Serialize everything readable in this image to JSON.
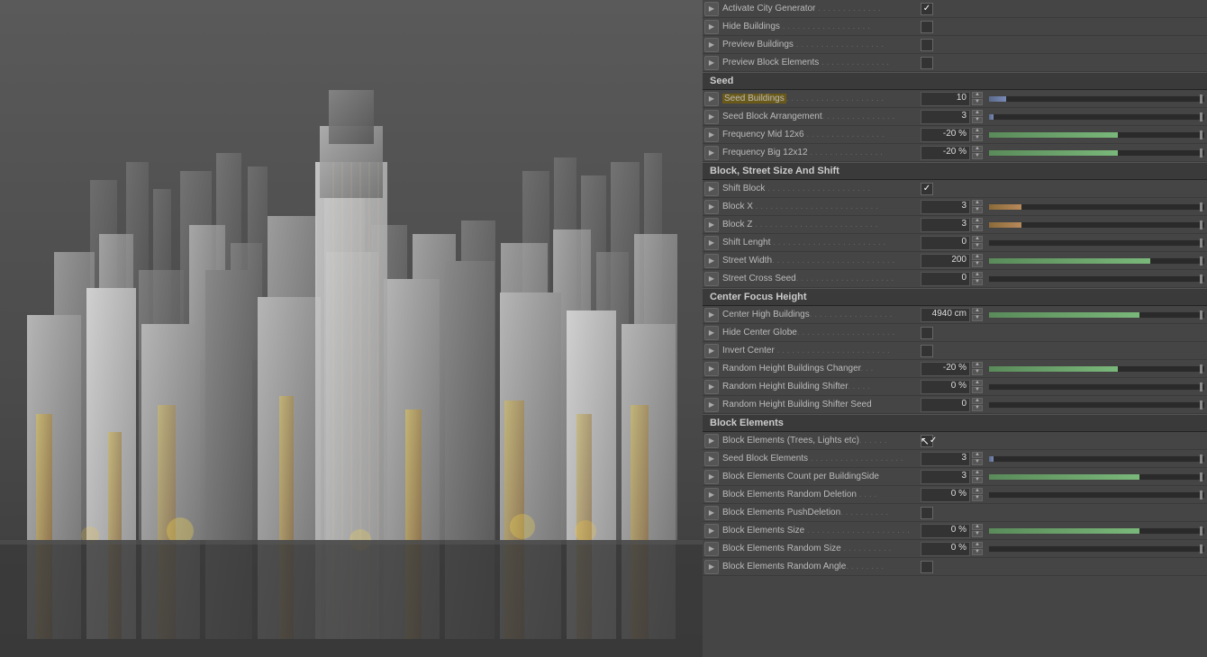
{
  "viewport": {
    "alt": "3D City Generator Viewport"
  },
  "panel": {
    "sections": [
      {
        "id": "top-controls",
        "label": null,
        "rows": [
          {
            "id": "activate-city",
            "label": "Activate City Generator",
            "dots": " . . . . . . . . . . . . .",
            "type": "checkbox",
            "checked": true
          },
          {
            "id": "hide-buildings",
            "label": "Hide Buildings",
            "dots": " . . . . . . . . . . . . . . . . . .",
            "type": "checkbox",
            "checked": false
          }
        ]
      },
      {
        "id": "preview-section",
        "label": null,
        "rows": [
          {
            "id": "preview-buildings",
            "label": "Preview Buildings",
            "dots": " . . . . . . . . . . . . . . . . . .",
            "type": "checkbox",
            "checked": false
          },
          {
            "id": "preview-block-elements",
            "label": "Preview Block Elements",
            "dots": " . . . . . . . . . . . . . .",
            "type": "checkbox",
            "checked": false
          }
        ]
      },
      {
        "id": "seed-section",
        "label": "Seed",
        "rows": [
          {
            "id": "seed-buildings",
            "label": "Seed Buildings",
            "dots": ". . . . . . . . . . . . . . . . . . . .",
            "type": "number-slider",
            "value": "10",
            "highlighted": true,
            "sliderPercent": 8,
            "sliderColor": "blue"
          },
          {
            "id": "seed-block-arrangement",
            "label": "Seed Block Arrangement",
            "dots": ". . . . . . . . . . . . . . .",
            "type": "number-slider",
            "value": "3",
            "sliderPercent": 2,
            "sliderColor": "blue"
          },
          {
            "id": "frequency-mid",
            "label": "Frequency Mid 12x6",
            "dots": " . . . . . . . . . . . . . . . .",
            "type": "number-slider",
            "value": "-20 %",
            "sliderPercent": 60,
            "sliderColor": "green"
          },
          {
            "id": "frequency-big",
            "label": "Frequency Big 12x12",
            "dots": " . . . . . . . . . . . . . . .",
            "type": "number-slider",
            "value": "-20 %",
            "sliderPercent": 60,
            "sliderColor": "green"
          }
        ]
      },
      {
        "id": "block-street-section",
        "label": "Block, Street Size And Shift",
        "rows": [
          {
            "id": "shift-block",
            "label": "Shift Block",
            "dots": " . . . . . . . . . . . . . . . . . . . . .",
            "type": "checkbox",
            "checked": true
          },
          {
            "id": "block-x",
            "label": "Block X",
            "dots": " . . . . . . . . . . . . . . . . . . . . . . . . .",
            "type": "number-slider",
            "value": "3",
            "sliderPercent": 15,
            "sliderColor": "orange"
          },
          {
            "id": "block-z",
            "label": "Block Z",
            "dots": " . . . . . . . . . . . . . . . . . . . . . . . . .",
            "type": "number-slider",
            "value": "3",
            "sliderPercent": 15,
            "sliderColor": "orange"
          },
          {
            "id": "shift-length",
            "label": "Shift Lenght",
            "dots": " . . . . . . . . . . . . . . . . . . . . . . .",
            "type": "number-slider",
            "value": "0",
            "sliderPercent": 0,
            "sliderColor": "green"
          },
          {
            "id": "street-width",
            "label": "Street Width",
            "dots": ". . . . . . . . . . . . . . . . . . . . . . . . .",
            "type": "number-slider",
            "value": "200",
            "sliderPercent": 75,
            "sliderColor": "green"
          },
          {
            "id": "street-cross-seed",
            "label": "Street Cross Seed",
            "dots": ". . . . . . . . . . . . . . . . . . . .",
            "type": "number-slider",
            "value": "0",
            "sliderPercent": 0,
            "sliderColor": "green"
          }
        ]
      },
      {
        "id": "center-focus-section",
        "label": "Center Focus Height",
        "rows": [
          {
            "id": "center-high-buildings",
            "label": "Center High Buildings",
            "dots": ". . . . . . . . . . . . . . . . .",
            "type": "number-slider",
            "value": "4940 cm",
            "sliderPercent": 70,
            "sliderColor": "green"
          },
          {
            "id": "hide-center-globe",
            "label": "Hide Center Globe",
            "dots": ". . . . . . . . . . . . . . . . . . . .",
            "type": "checkbox",
            "checked": false
          },
          {
            "id": "invert-center",
            "label": "Invert Center",
            "dots": " . . . . . . . . . . . . . . . . . . . . . . .",
            "type": "checkbox",
            "checked": false
          },
          {
            "id": "random-height-changer",
            "label": "Random Height Buildings Changer",
            "dots": ". . .",
            "type": "number-slider",
            "value": "-20 %",
            "sliderPercent": 60,
            "sliderColor": "green"
          },
          {
            "id": "random-height-shifter",
            "label": "Random Height Building Shifter",
            "dots": ". . . . .",
            "type": "number-slider",
            "value": "0 %",
            "sliderPercent": 0,
            "sliderColor": "green"
          },
          {
            "id": "random-height-shifter-seed",
            "label": "Random Height Building Shifter Seed",
            "dots": "",
            "type": "number-slider",
            "value": "0",
            "sliderPercent": 0,
            "sliderColor": "green"
          }
        ]
      },
      {
        "id": "block-elements-section",
        "label": "Block Elements",
        "rows": [
          {
            "id": "block-elements-trees",
            "label": "Block Elements (Trees, Lights etc)",
            "dots": ". . . . . .",
            "type": "checkbox",
            "checked": true,
            "hasCursor": true
          },
          {
            "id": "seed-block-elements",
            "label": "Seed Block Elements",
            "dots": " . . . . . . . . . . . . . . . . . . .",
            "type": "number-slider",
            "value": "3",
            "sliderPercent": 2,
            "sliderColor": "blue"
          },
          {
            "id": "block-elements-count",
            "label": "Block Elements Count per BuildingSide",
            "dots": "",
            "type": "number-slider",
            "value": "3",
            "sliderPercent": 70,
            "sliderColor": "green"
          },
          {
            "id": "block-elements-deletion",
            "label": "Block Elements Random Deletion",
            "dots": " . . . .",
            "type": "number-slider",
            "value": "0 %",
            "sliderPercent": 0,
            "sliderColor": "green"
          },
          {
            "id": "block-elements-pushdeletion",
            "label": "Block Elements PushDeletion",
            "dots": ". . . . . . . . . .",
            "type": "checkbox",
            "checked": false
          },
          {
            "id": "block-elements-size",
            "label": "Block Elements Size",
            "dots": " . . . . . . . . . . . . . . . . . . . . .",
            "type": "number-slider",
            "value": "0 %",
            "sliderPercent": 70,
            "sliderColor": "green"
          },
          {
            "id": "block-elements-random-size",
            "label": "Block Elements Random Size",
            "dots": " . . . . . . . . . .",
            "type": "number-slider",
            "value": "0 %",
            "sliderPercent": 0,
            "sliderColor": "green"
          },
          {
            "id": "block-elements-random-angle",
            "label": "Block Elements Random Angle",
            "dots": ". . . . . . . .",
            "type": "checkbox",
            "checked": false
          }
        ]
      }
    ]
  }
}
